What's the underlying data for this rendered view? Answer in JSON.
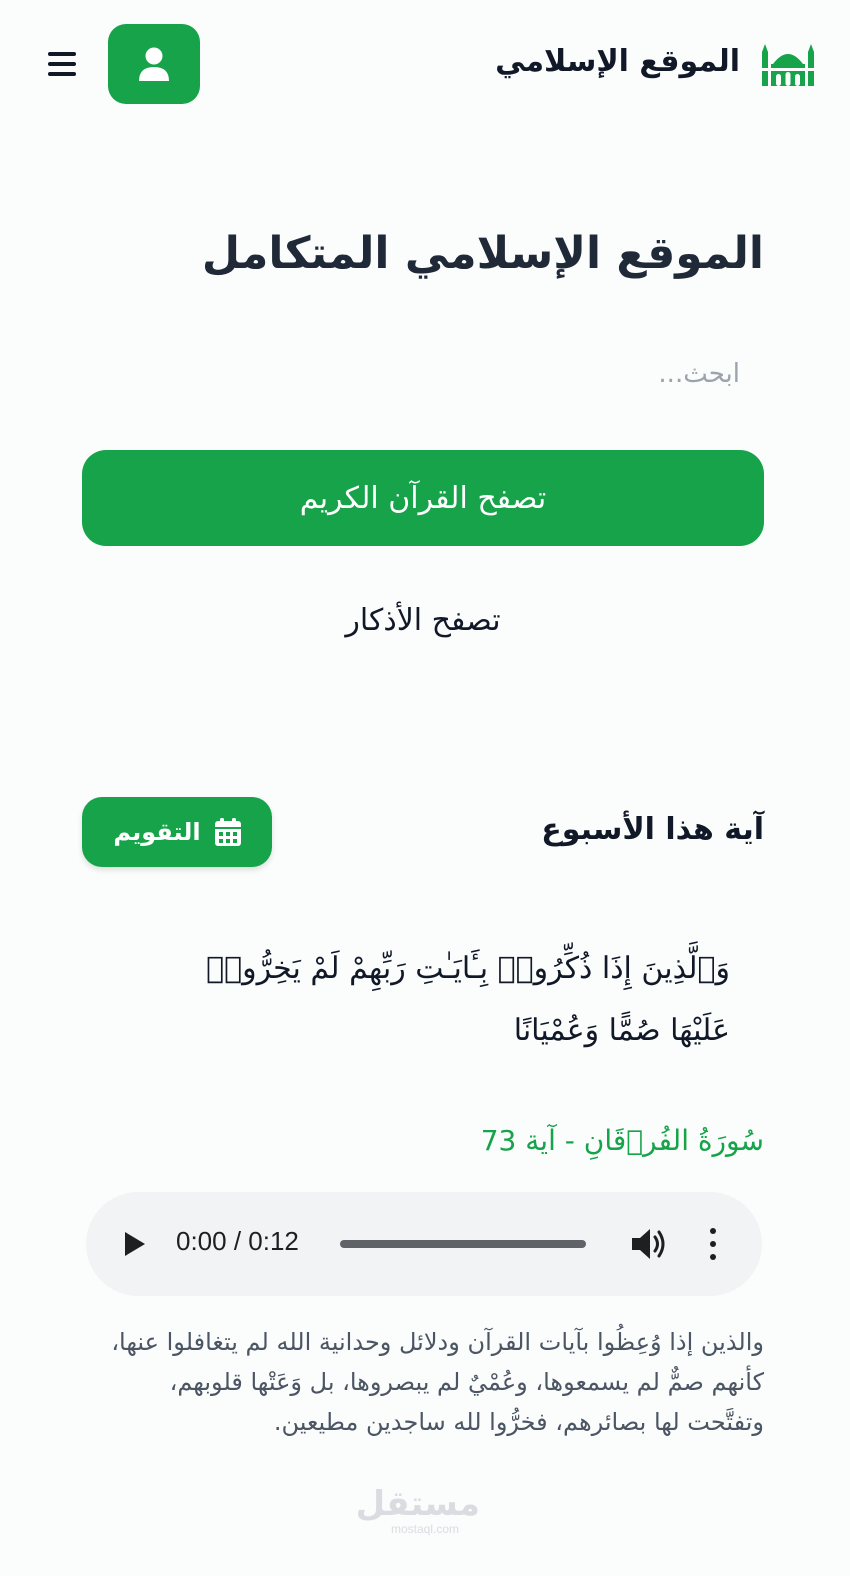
{
  "header": {
    "site_name": "الموقع الإسلامي",
    "logo_icon": "mosque-icon",
    "profile_icon": "user-icon",
    "menu_icon": "hamburger-menu-icon",
    "accent_color": "#16a34a"
  },
  "hero": {
    "title": "الموقع الإسلامي المتكامل",
    "search_placeholder": "ابحث...",
    "search_value": "",
    "quran_button_label": "تصفح القرآن الكريم",
    "adhkar_link_label": "تصفح الأذكار"
  },
  "weekly_verse": {
    "section_title": "آية هذا الأسبوع",
    "calendar_button_label": "التقويم",
    "calendar_icon": "calendar-icon",
    "verse": "وَٱلَّذِينَ إِذَا ذُكِّرُوا۟ بِـَٔايَـٰتِ رَبِّهِمْ لَمْ يَخِرُّوا۟ عَلَيْهَا صُمًّا وَعُمْيَانًا",
    "surah_reference": "سُورَةُ الفُرۡقَانِ - آية 73",
    "audio": {
      "time_display": "0:00 / 0:12",
      "progress": 0,
      "play_icon": "play-icon",
      "volume_icon": "volume-icon",
      "more_icon": "more-options-icon"
    },
    "tafsir": "والذين إذا وُعِظُوا بآيات القرآن ودلائل وحدانية الله لم يتغافلوا عنها، كأنهم صمٌّ لم يسمعوها، وعُمْيٌ لم يبصروها، بل وَعَتْها قلوبهم، وتفتَّحت لها بصائرهم، فخرُّوا لله ساجدين مطيعين."
  },
  "footer": {
    "watermark_ar": "مستقل",
    "watermark_en": "mostaql.com"
  }
}
